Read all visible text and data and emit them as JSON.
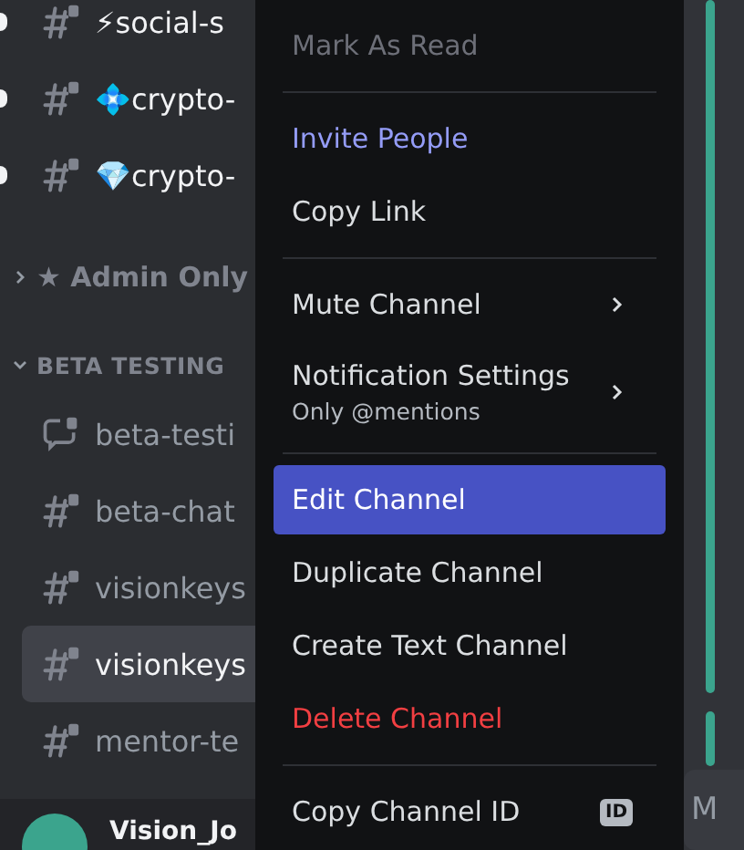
{
  "sidebar": {
    "channels": [
      {
        "name": "⚡social-s",
        "kind": "text",
        "locked": true,
        "unread": true,
        "selected": false
      },
      {
        "name": "💠crypto-",
        "kind": "text",
        "locked": true,
        "unread": true,
        "selected": false
      },
      {
        "name": "💎crypto-",
        "kind": "text",
        "locked": true,
        "unread": true,
        "selected": false
      }
    ],
    "categories": [
      {
        "name": "★ Admin Only",
        "expanded": false
      },
      {
        "name": "BETA TESTING",
        "expanded": true,
        "channels": [
          {
            "name": "beta-testi",
            "kind": "forum",
            "locked": true,
            "unread": false,
            "selected": false
          },
          {
            "name": "beta-chat",
            "kind": "text",
            "locked": true,
            "unread": false,
            "selected": false
          },
          {
            "name": "visionkeys",
            "kind": "text",
            "locked": true,
            "unread": false,
            "selected": false
          },
          {
            "name": "visionkeys",
            "kind": "text",
            "locked": true,
            "unread": false,
            "selected": true
          },
          {
            "name": "mentor-te",
            "kind": "text",
            "locked": true,
            "unread": false,
            "selected": false
          }
        ]
      }
    ],
    "user": {
      "name": "Vision_Jo"
    }
  },
  "context_menu": {
    "sections": [
      [
        {
          "label": "Mark As Read",
          "kind": "disabled",
          "selected": false
        }
      ],
      [
        {
          "label": "Invite People",
          "kind": "accent",
          "selected": false
        },
        {
          "label": "Copy Link",
          "kind": "normal",
          "selected": false
        }
      ],
      [
        {
          "label": "Mute Channel",
          "kind": "normal",
          "selected": false,
          "submenu": true
        },
        {
          "label": "Notification Settings",
          "subtitle": "Only @mentions",
          "kind": "normal",
          "selected": false,
          "submenu": true
        }
      ],
      [
        {
          "label": "Edit Channel",
          "kind": "normal",
          "selected": true
        },
        {
          "label": "Duplicate Channel",
          "kind": "normal",
          "selected": false
        },
        {
          "label": "Create Text Channel",
          "kind": "normal",
          "selected": false
        },
        {
          "label": "Delete Channel",
          "kind": "danger",
          "selected": false
        }
      ],
      [
        {
          "label": "Copy Channel ID",
          "kind": "normal",
          "selected": false,
          "badge": "ID"
        }
      ]
    ]
  },
  "message_field": {
    "placeholder": "M"
  }
}
